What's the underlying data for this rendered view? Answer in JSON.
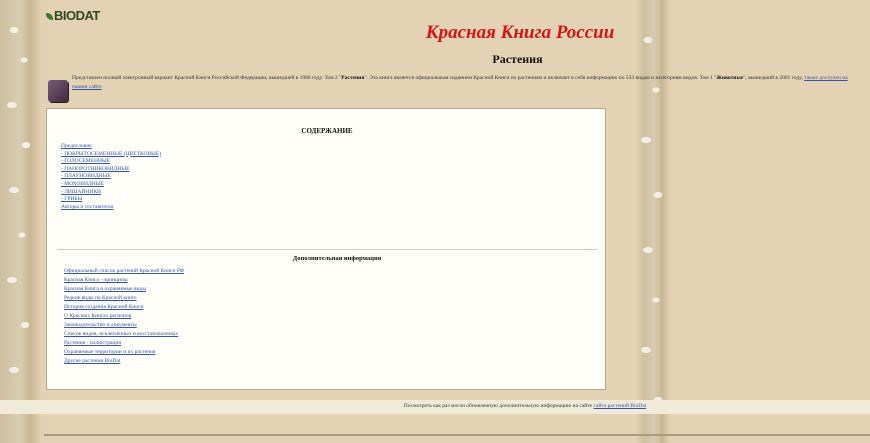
{
  "header": {
    "logo_text": "BIODAT",
    "site_title": "Красная Книга России",
    "section_title": "Растения"
  },
  "intro": {
    "text_start": "Представлен полный электронный вариант Красной Книги Российской Федерации, вышедшей в 1988 году. Том 2 ",
    "bold_1": "Растения",
    "text_mid": ". Эта книга является официальным изданием Красной Книги по растениям и включает в себя информацию по 533 видам и категориям видов. Том 1 ",
    "bold_2": "Животные",
    "text_end": ", вышедший в 2001 году, ",
    "link": "также доступен на нашем сайте"
  },
  "toc": {
    "title": "СОДЕРЖАНИЕ",
    "items": [
      "Предисловие",
      "- ПОКРЫТОСЕМЕННЫЕ (ЦВЕТКОВЫЕ)",
      "- ГОЛОСЕМЕННЫЕ",
      "- ПАПОРОТНИКОВИДНЫЕ",
      "- ПЛАУНОВИДНЫЕ",
      "- МОХОВИДНЫЕ",
      "- ЛИШАЙНИКИ",
      "- ГРИБЫ",
      "Авторы и составители"
    ]
  },
  "extra": {
    "title": "Дополнительная информация",
    "items": [
      "Официальный список растений Красной Книги РФ",
      "Красная Книга - принципы",
      "Красная Книга и охраняемые виды",
      "Редкие виды по Красной книге",
      "История создания Красной Книги",
      "О Красных Книгах регионов",
      "Законодательство и документы",
      "Список видов, исключённых и восстановленных",
      "Растения - иллюстрации",
      "Охраняемые территории и их растения",
      "Другие растения BioDat"
    ]
  },
  "footer": {
    "text": "Посмотреть как раз могли обновленную дополнительную информацию на сайте ",
    "link": "сайта растений BioDat"
  },
  "colors": {
    "title_red": "#d81515",
    "link_blue": "#3355aa",
    "background": "#e3d2b4"
  }
}
